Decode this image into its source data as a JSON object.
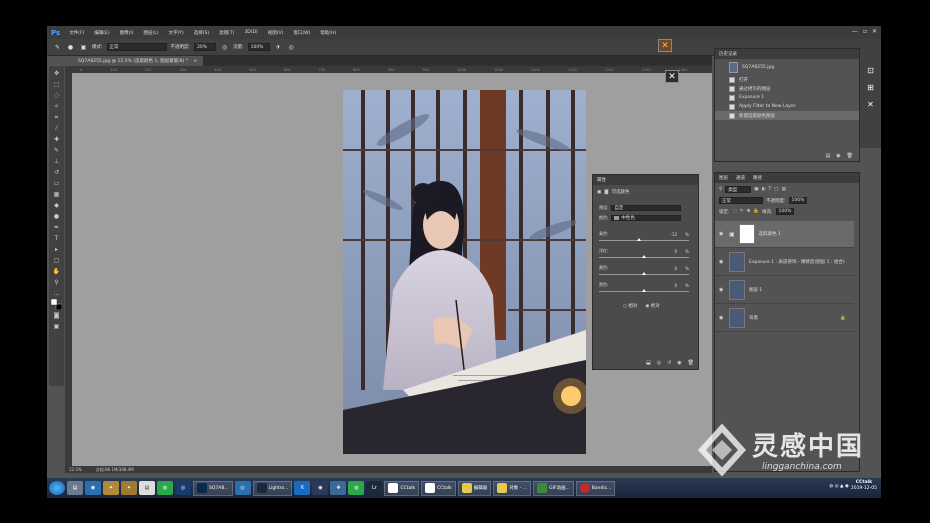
{
  "app": {
    "logo": "Ps"
  },
  "menubar": {
    "items": [
      "文件(F)",
      "编辑(E)",
      "图像(I)",
      "图层(L)",
      "文字(Y)",
      "选择(S)",
      "滤镜(T)",
      "3D(D)",
      "视图(V)",
      "窗口(W)",
      "帮助(H)"
    ]
  },
  "window_controls": {
    "minimize": "—",
    "restore": "▫",
    "close": "✕"
  },
  "options": {
    "mode_label": "模式:",
    "mode_value": "正常",
    "opacity_label": "不透明度:",
    "opacity_value": "20%",
    "flow_label": "流量:",
    "flow_value": "100%"
  },
  "document": {
    "tab_title": "SQ7A8255.jpg @ 12.5% (选取颜色 1, 图层蒙版/8) *",
    "close": "×"
  },
  "ruler": {
    "ticks": [
      "0",
      "100",
      "200",
      "300",
      "400",
      "500",
      "600",
      "700",
      "800",
      "900",
      "950",
      "1000",
      "1050",
      "1100",
      "1150",
      "1200",
      "1250",
      "1300",
      "1350",
      "1400",
      "1450"
    ]
  },
  "status": {
    "zoom": "12.5%",
    "doc_size": "文档:86.1M/308.4M"
  },
  "history": {
    "title": "历史记录",
    "snapshot": "SQ7A8255.jpg",
    "items": [
      "打开",
      "通过拷贝的图层",
      "Exposure 1",
      "Apply Filter to New Layer",
      "新建选取颜色图层"
    ]
  },
  "properties": {
    "title": "属性",
    "adjustment": "可选颜色",
    "preset_label": "预设:",
    "preset_value": "自定",
    "colors_label": "颜色:",
    "colors_value": "中性色",
    "sliders": [
      {
        "label": "青色:",
        "value": "-12",
        "unit": "%"
      },
      {
        "label": "洋红:",
        "value": "0",
        "unit": "%"
      },
      {
        "label": "黄色:",
        "value": "0",
        "unit": "%"
      },
      {
        "label": "黑色:",
        "value": "0",
        "unit": "%"
      }
    ],
    "slider_levels": [
      -12,
      0,
      0,
      0
    ],
    "method_relative": "相对",
    "method_absolute": "绝对"
  },
  "layers": {
    "tabs": [
      "图层",
      "通道",
      "路径"
    ],
    "kind_label": "类型",
    "blend_value": "正常",
    "opacity_label": "不透明度:",
    "opacity_value": "100%",
    "lock_label": "锁定:",
    "fill_label": "填充:",
    "fill_value": "100%",
    "rows": [
      {
        "name": "选取颜色 1"
      },
      {
        "name": "Exposure 1 : 表皮修饰 - 精修后(图层 1 : 组合)"
      },
      {
        "name": "图层 1"
      },
      {
        "name": "背景"
      }
    ]
  },
  "taskbar": {
    "tasks": [
      "SQ7A8...",
      "Lightro...",
      "CCtalk",
      "CCtalk",
      "编辑器",
      "对象 - ...",
      "GIF动画...",
      "Bandic..."
    ],
    "tray_time": "CCtalk",
    "tray_date": "2019-12-05"
  },
  "watermark": {
    "cn": "灵感中国",
    "en": "lingganchina.com"
  },
  "colors": {
    "accent": "#4aa3ff",
    "panel": "#535353",
    "dark": "#3c3c3c",
    "canvas": "#9f9f9f"
  }
}
